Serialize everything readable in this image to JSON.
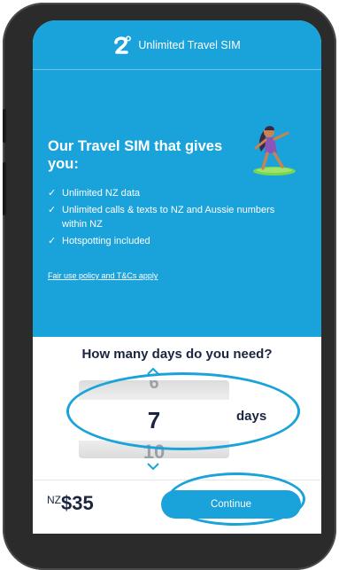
{
  "header": {
    "title": "Unlimited Travel SIM",
    "logo_icon": "2degrees-logo-icon"
  },
  "hero": {
    "title": "Our Travel SIM that gives you:",
    "features": [
      "Unlimited NZ data",
      "Unlimited calls & texts to NZ and Aussie numbers within NZ",
      "Hotspotting included"
    ],
    "terms_link": "Fair use policy and T&Cs apply"
  },
  "days": {
    "question": "How many days do you need?",
    "prev": "6",
    "current": "7",
    "next": "10",
    "unit": "days"
  },
  "footer": {
    "price_prefix": "NZ",
    "price_value": "$35",
    "continue_label": "Continue"
  },
  "colors": {
    "brand_blue": "#1aa2da",
    "navy": "#1c2540"
  }
}
